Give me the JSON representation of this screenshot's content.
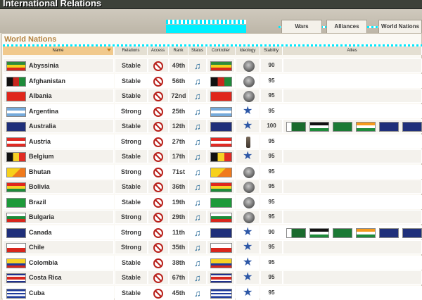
{
  "window": {
    "title": "International Relations"
  },
  "tabs": [
    {
      "label": "Wars"
    },
    {
      "label": "Alliances"
    },
    {
      "label": "World Nations"
    }
  ],
  "panel": {
    "title": "World Nations"
  },
  "columns": {
    "name": "Name",
    "relations": "Relations",
    "access": "Access",
    "rank": "Rank",
    "status": "Status",
    "controller": "Controller",
    "ideology": "Ideology",
    "stability": "Stability",
    "allies": "Allies"
  },
  "icons": {
    "access": "no-access-icon",
    "status": "eagle-icon",
    "ideology_types": [
      "bust-icon",
      "star-icon",
      "statue-icon"
    ]
  },
  "nations": [
    {
      "name": "Abyssinia",
      "relations": "Stable",
      "rank": "49th",
      "ideology": "bust",
      "stability": "90",
      "flag": "abyssinia",
      "allies": []
    },
    {
      "name": "Afghanistan",
      "relations": "Stable",
      "rank": "56th",
      "ideology": "bust",
      "stability": "95",
      "flag": "afghanistan",
      "allies": []
    },
    {
      "name": "Albania",
      "relations": "Stable",
      "rank": "72nd",
      "ideology": "bust",
      "stability": "95",
      "flag": "albania",
      "allies": []
    },
    {
      "name": "Argentina",
      "relations": "Strong",
      "rank": "25th",
      "ideology": "star",
      "stability": "95",
      "flag": "argentina",
      "allies": []
    },
    {
      "name": "Australia",
      "relations": "Stable",
      "rank": "12th",
      "ideology": "star",
      "stability": "100",
      "flag": "australia",
      "allies": [
        "pakistan",
        "jordan",
        "saudi",
        "india",
        "australia",
        "canada"
      ]
    },
    {
      "name": "Austria",
      "relations": "Strong",
      "rank": "27th",
      "ideology": "statue",
      "stability": "95",
      "flag": "austria",
      "allies": []
    },
    {
      "name": "Belgium",
      "relations": "Stable",
      "rank": "17th",
      "ideology": "star",
      "stability": "95",
      "flag": "belgium",
      "allies": []
    },
    {
      "name": "Bhutan",
      "relations": "Strong",
      "rank": "71st",
      "ideology": "bust",
      "stability": "95",
      "flag": "bhutan",
      "allies": []
    },
    {
      "name": "Bolivia",
      "relations": "Stable",
      "rank": "36th",
      "ideology": "bust",
      "stability": "95",
      "flag": "bolivia",
      "allies": []
    },
    {
      "name": "Brazil",
      "relations": "Stable",
      "rank": "19th",
      "ideology": "bust",
      "stability": "95",
      "flag": "brazil",
      "allies": []
    },
    {
      "name": "Bulgaria",
      "relations": "Strong",
      "rank": "29th",
      "ideology": "bust",
      "stability": "95",
      "flag": "bulgaria",
      "allies": []
    },
    {
      "name": "Canada",
      "relations": "Strong",
      "rank": "11th",
      "ideology": "star",
      "stability": "90",
      "flag": "canada",
      "allies": [
        "pakistan",
        "jordan",
        "saudi",
        "india",
        "australia",
        "canada"
      ]
    },
    {
      "name": "Chile",
      "relations": "Strong",
      "rank": "35th",
      "ideology": "star",
      "stability": "95",
      "flag": "chile",
      "allies": []
    },
    {
      "name": "Colombia",
      "relations": "Stable",
      "rank": "38th",
      "ideology": "star",
      "stability": "95",
      "flag": "colombia",
      "allies": []
    },
    {
      "name": "Costa Rica",
      "relations": "Stable",
      "rank": "67th",
      "ideology": "star",
      "stability": "95",
      "flag": "costarica",
      "allies": []
    },
    {
      "name": "Cuba",
      "relations": "Stable",
      "rank": "45th",
      "ideology": "star",
      "stability": "95",
      "flag": "cuba",
      "allies": []
    }
  ]
}
